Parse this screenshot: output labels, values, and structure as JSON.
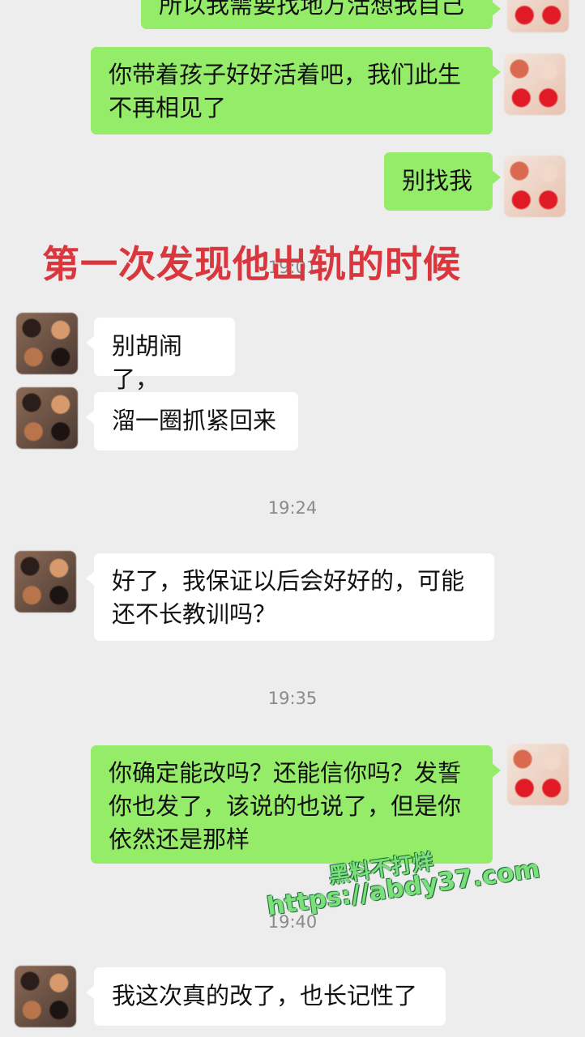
{
  "overlay_caption": "第一次发现他出轨的时候",
  "messages": [
    {
      "side": "sent",
      "text": "所以我需要找地方活想我自己"
    },
    {
      "side": "sent",
      "line1": "你带着孩子好好活着吧，我们此生",
      "line2": "不再相见了"
    },
    {
      "side": "sent",
      "text": "别找我"
    },
    {
      "timestamp": "19:01"
    },
    {
      "side": "received",
      "text": "别胡闹了，"
    },
    {
      "side": "received",
      "text": "溜一圈抓紧回来"
    },
    {
      "timestamp": "19:24"
    },
    {
      "side": "received",
      "line1": "好了，我保证以后会好好的，可能",
      "line2": "还不长教训吗？"
    },
    {
      "timestamp": "19:35"
    },
    {
      "side": "sent",
      "line1": "你确定能改吗？还能信你吗？发誓",
      "line2": "你也发了，该说的也说了，但是你",
      "line3": "依然还是那样"
    },
    {
      "timestamp": "19:40"
    },
    {
      "side": "received",
      "text": "我这次真的改了，也长记性了"
    }
  ],
  "watermark": {
    "line1": "黑料不打烊",
    "line2": "https://abdy37.com"
  },
  "colors": {
    "sent_bubble": "#95ec69",
    "received_bubble": "#ffffff",
    "background": "#ededed",
    "caption": "#d9363e"
  }
}
